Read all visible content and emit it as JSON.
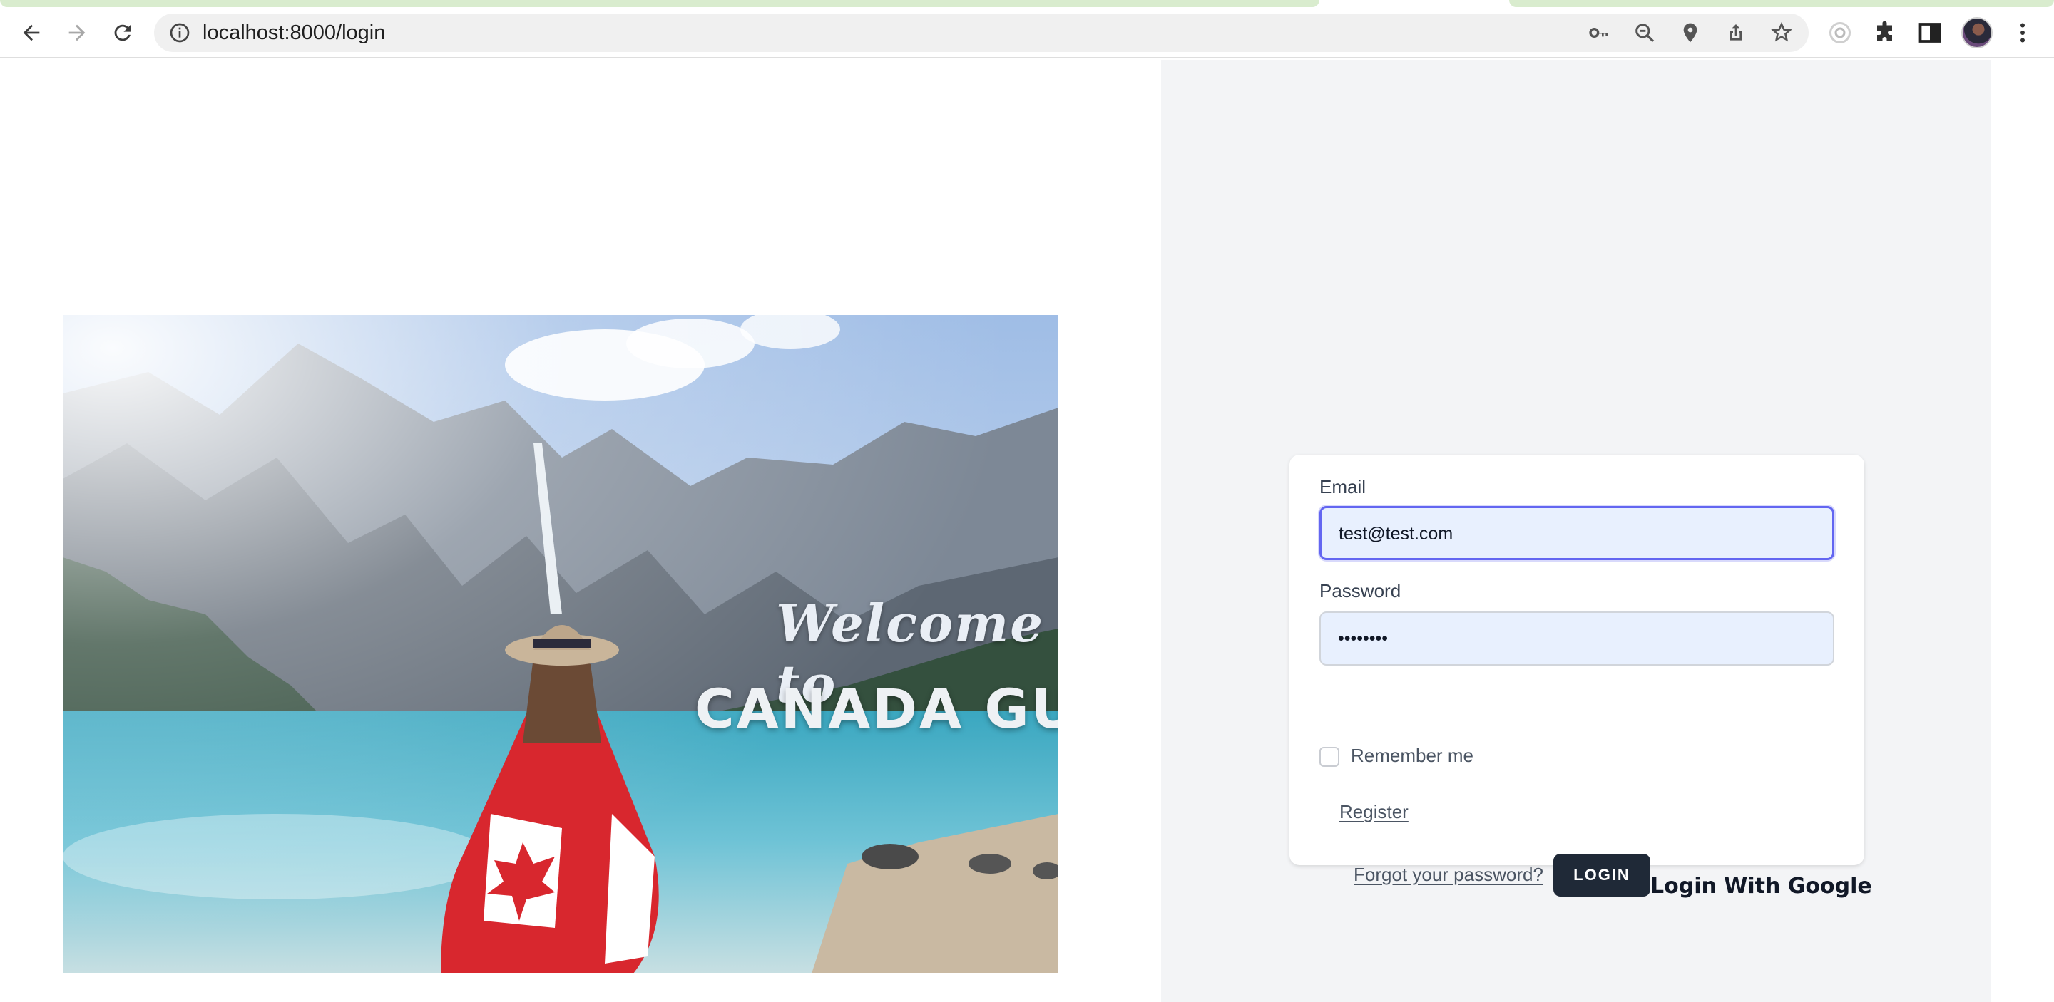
{
  "browser": {
    "url": "localhost:8000/login",
    "icons": [
      "back-arrow-icon",
      "forward-arrow-icon",
      "reload-icon",
      "site-info-icon",
      "key-icon",
      "zoom-out-icon",
      "location-pin-icon",
      "share-icon",
      "bookmark-star-icon",
      "extension-icon",
      "puzzle-extension-icon",
      "side-panel-icon",
      "profile-avatar",
      "more-menu-icon"
    ]
  },
  "hero": {
    "welcome_text": "Welcome to",
    "title_text": "CANADA GUIDE"
  },
  "login": {
    "email_label": "Email",
    "email_value": "test@test.com",
    "password_label": "Password",
    "password_value": "••••••••",
    "remember_label": "Remember me",
    "register_link": "Register",
    "forgot_link": "Forgot your password?",
    "login_button": "LOGIN",
    "google_button": "Login With Google"
  },
  "colors": {
    "primary_button": "#1f2937",
    "focus_ring": "#6366f1",
    "input_autofill_bg": "#e8f0fe",
    "panel_bg": "#f3f4f6"
  }
}
